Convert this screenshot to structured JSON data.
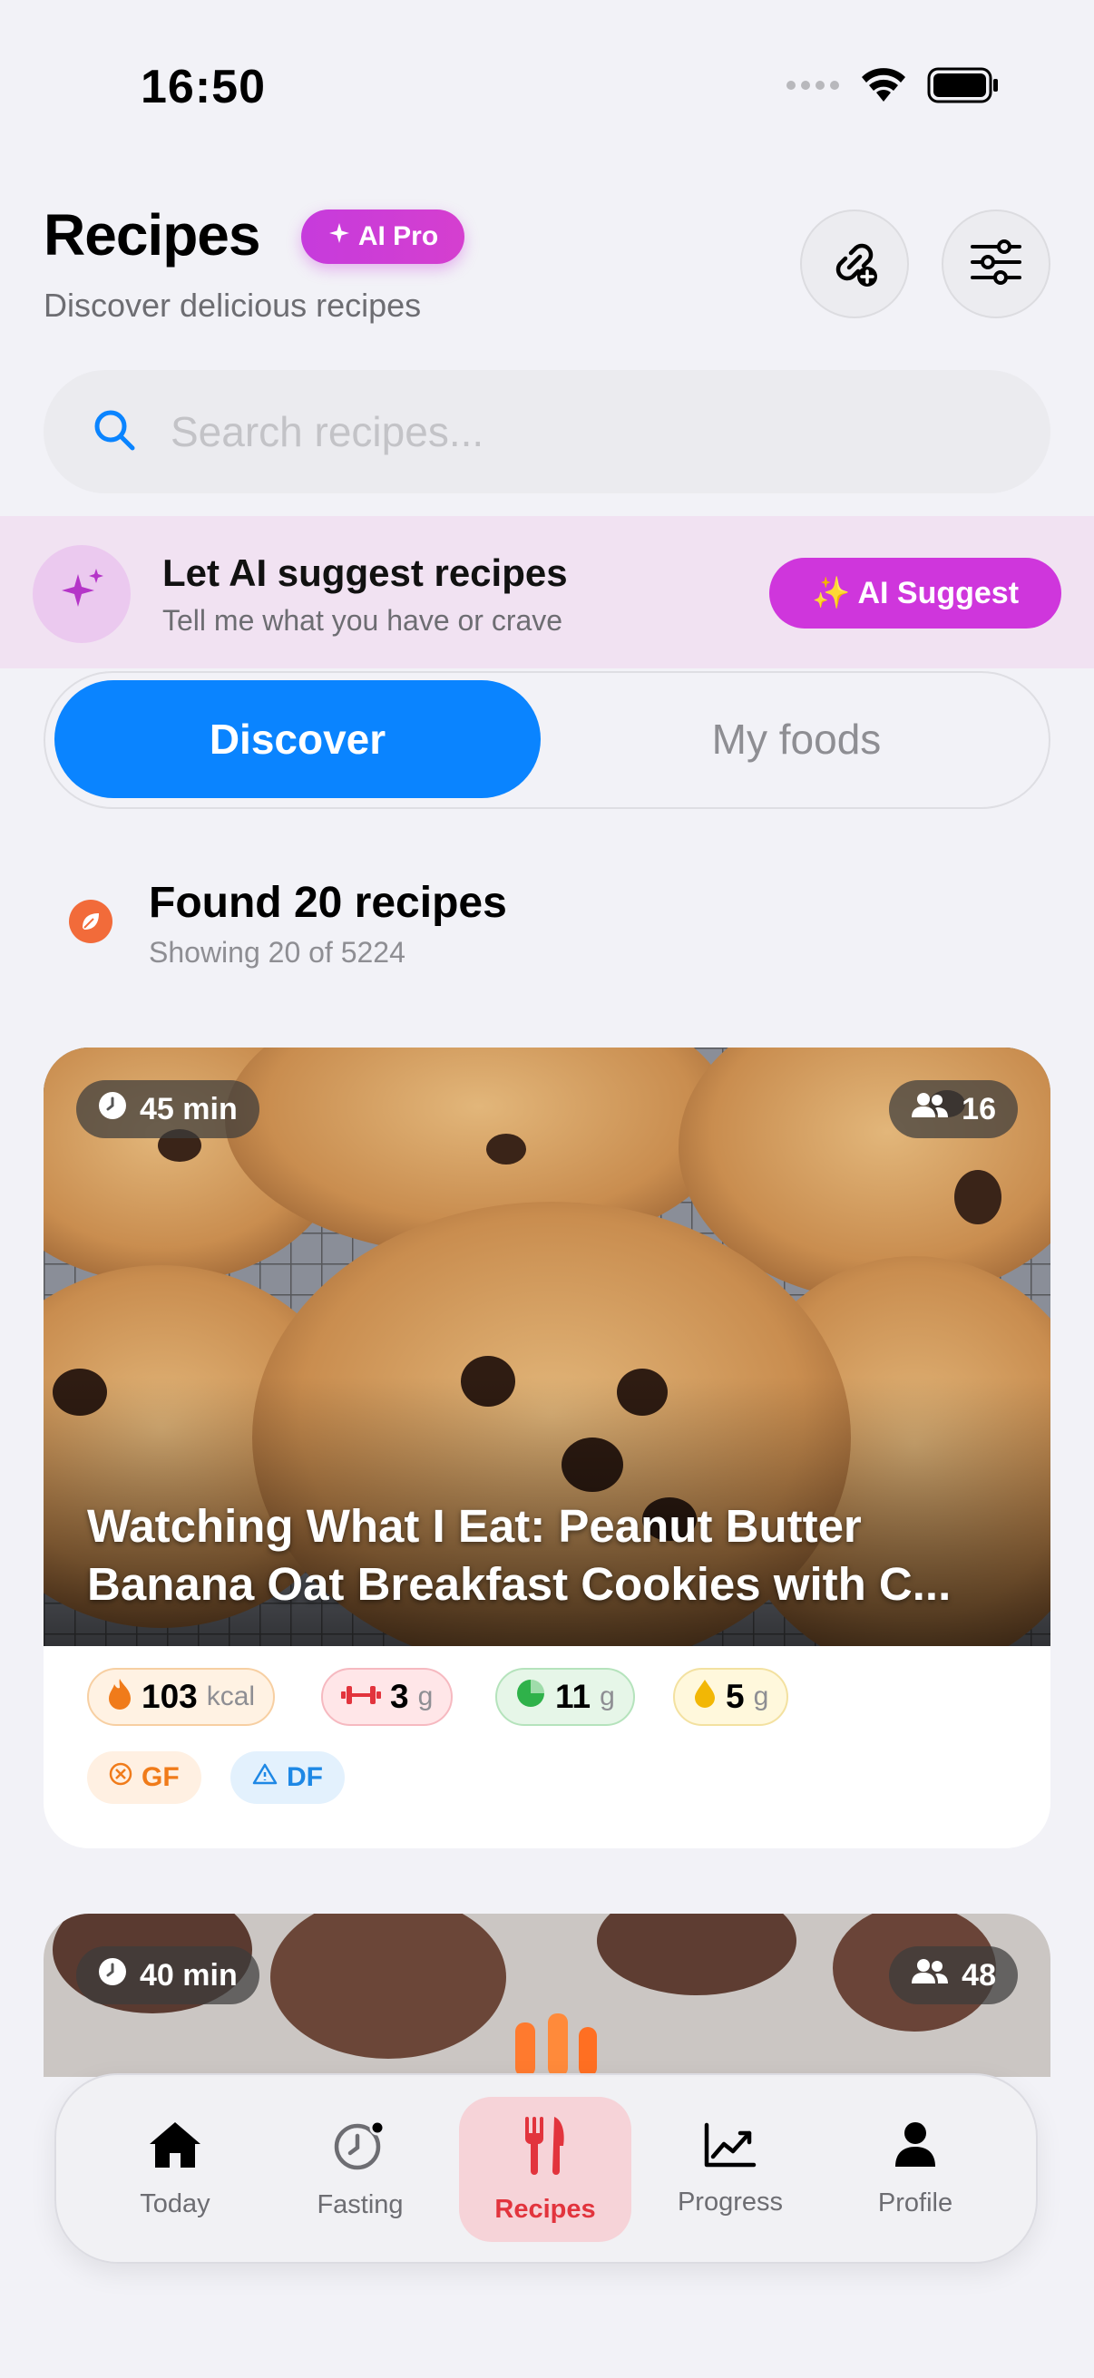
{
  "status_bar": {
    "time": "16:50"
  },
  "header": {
    "title": "Recipes",
    "badge": "AI Pro",
    "subtitle": "Discover delicious recipes"
  },
  "search": {
    "placeholder": "Search recipes..."
  },
  "ai_banner": {
    "title": "Let AI suggest recipes",
    "subtitle": "Tell me what you have or crave",
    "button": "✨ AI Suggest"
  },
  "tabs": [
    {
      "label": "Discover",
      "active": true
    },
    {
      "label": "My foods",
      "active": false
    }
  ],
  "results": {
    "title": "Found 20 recipes",
    "subtitle": "Showing 20 of 5224"
  },
  "recipes": [
    {
      "time": "45 min",
      "servings": "16",
      "title": "Watching What I Eat: Peanut Butter Banana Oat Breakfast Cookies with C...",
      "kcal": "103",
      "kcal_unit": "kcal",
      "protein": "3",
      "protein_unit": "g",
      "carbs": "11",
      "carbs_unit": "g",
      "fat": "5",
      "fat_unit": "g",
      "tags": [
        "GF",
        "DF"
      ]
    },
    {
      "time": "40 min",
      "servings": "48"
    }
  ],
  "nav": [
    {
      "label": "Today",
      "icon": "home-icon"
    },
    {
      "label": "Fasting",
      "icon": "timer-icon"
    },
    {
      "label": "Recipes",
      "icon": "fork-knife-icon",
      "active": true
    },
    {
      "label": "Progress",
      "icon": "chart-icon"
    },
    {
      "label": "Profile",
      "icon": "person-icon"
    }
  ],
  "colors": {
    "accent_blue": "#0a84ff",
    "ai_magenta": "#cf36dc",
    "recipes_red": "#e2343d"
  }
}
